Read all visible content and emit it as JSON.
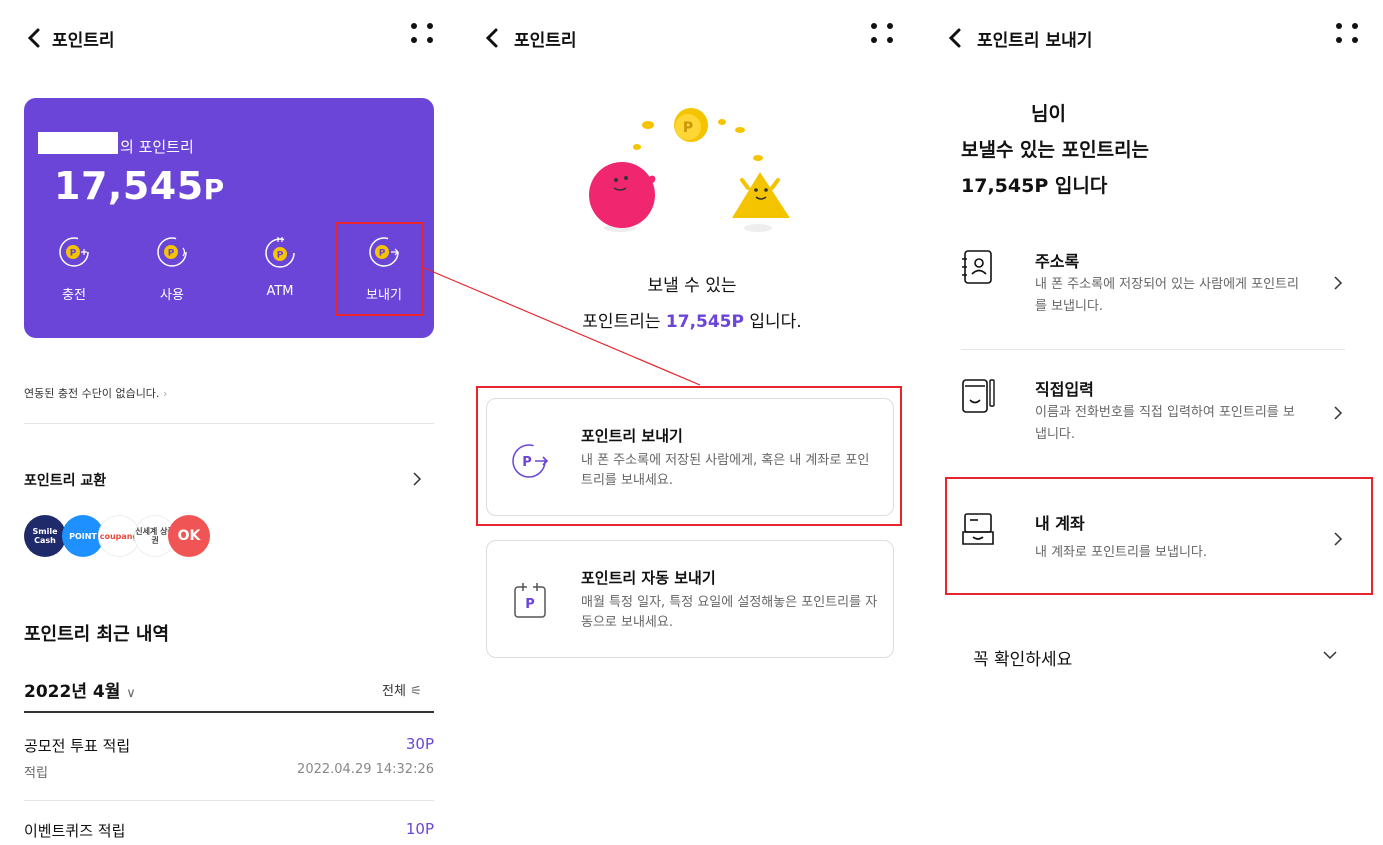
{
  "panel1": {
    "header": {
      "title": "포인트리"
    },
    "card": {
      "owner_suffix": "의 포인트리",
      "balance": "17,545",
      "balance_unit": "P",
      "actions": [
        {
          "label": "충전",
          "icon": "point-charge-icon"
        },
        {
          "label": "사용",
          "icon": "point-use-icon"
        },
        {
          "label": "ATM",
          "icon": "point-atm-icon"
        },
        {
          "label": "보내기",
          "icon": "point-send-icon"
        }
      ]
    },
    "linked_text": "연동된 충전 수단이 없습니다.",
    "exchange_title": "포인트리 교환",
    "partners": [
      "Smile Cash",
      "POINT",
      "coupang",
      "신세계 상품권",
      "OK"
    ],
    "history_title": "포인트리 최근 내역",
    "month": "2022년 4월",
    "filter_label": "전체",
    "transactions": [
      {
        "name": "공모전 투표 적립",
        "amount": "30P",
        "type": "적립",
        "date": "2022.04.29 14:32:26"
      },
      {
        "name": "이벤트퀴즈 적립",
        "amount": "10P"
      }
    ]
  },
  "panel2": {
    "header": {
      "title": "포인트리"
    },
    "message_line1": "보낼 수 있는",
    "message_prefix": "포인트리는 ",
    "message_amount": "17,545P",
    "message_suffix": " 입니다.",
    "options": [
      {
        "title": "포인트리 보내기",
        "desc": "내 폰 주소록에 저장된 사람에게, 혹은 내 계좌로 포인트리를 보내세요.",
        "icon": "point-send-icon"
      },
      {
        "title": "포인트리 자동 보내기",
        "desc": "매월 특정 일자, 특정 요일에 설정해놓은 포인트리를 자동으로 보내세요.",
        "icon": "calendar-point-icon"
      }
    ]
  },
  "panel3": {
    "header": {
      "title": "포인트리 보내기"
    },
    "heading_line1": "님이",
    "heading_line2": "보낼수 있는 포인트리는",
    "heading_line3": "17,545P 입니다",
    "items": [
      {
        "title": "주소록",
        "desc": "내 폰 주소록에 저장되어 있는 사람에게 포인트리를 보냅니다.",
        "icon": "contacts-icon"
      },
      {
        "title": "직접입력",
        "desc": "이름과 전화번호를 직접 입력하여 포인트리를 보냅니다.",
        "icon": "direct-input-icon"
      },
      {
        "title": "내 계좌",
        "desc": "내 계좌로 포인트리를 보냅니다.",
        "icon": "wallet-icon"
      }
    ],
    "notice_label": "꼭 확인하세요"
  },
  "colors": {
    "brand_purple": "#6a45d8",
    "highlight_red": "#e8242c"
  }
}
